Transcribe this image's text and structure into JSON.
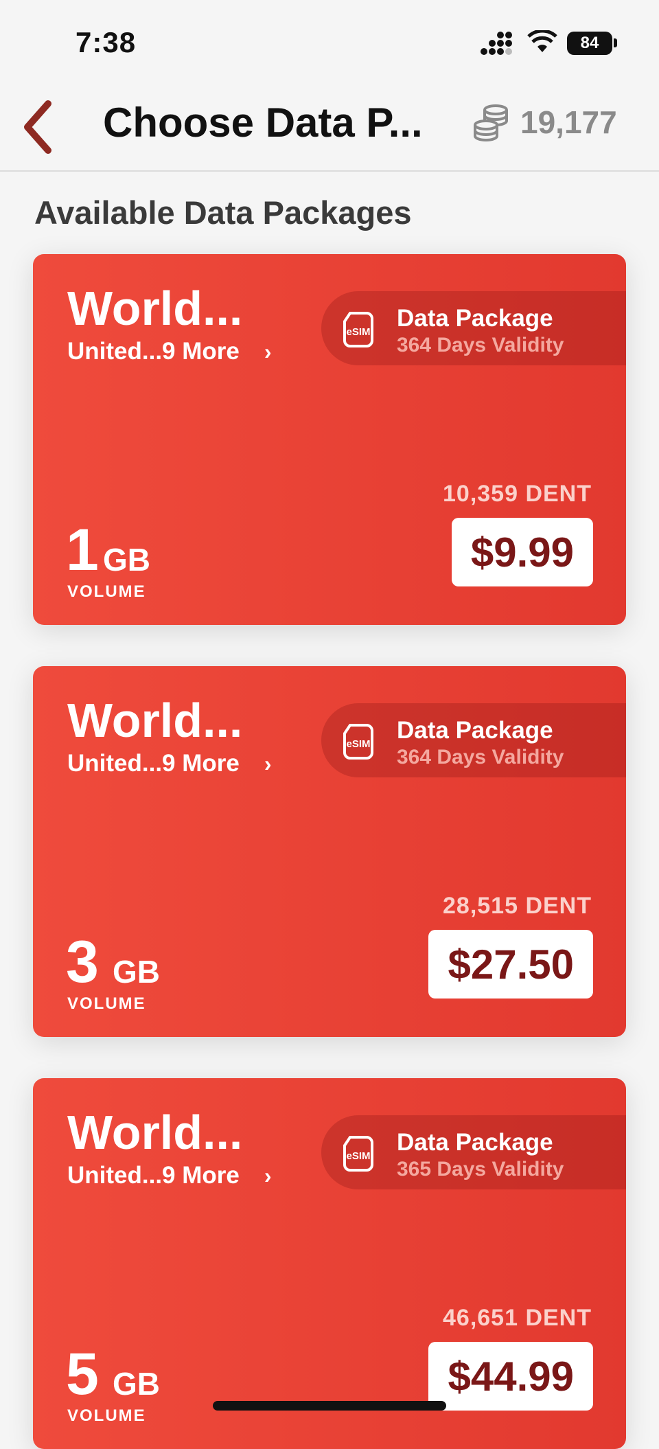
{
  "status_bar": {
    "time": "7:38",
    "battery": "84"
  },
  "nav": {
    "title": "Choose Data P...",
    "coin_balance": "19,177"
  },
  "section_heading": "Available Data Packages",
  "packages": [
    {
      "title": "World...",
      "subtitle": "United...9 More",
      "chevron": "›",
      "type": "Data Package",
      "validity": "364 Days Validity",
      "dent": "10,359 DENT",
      "price": "$9.99",
      "volume": "1",
      "unit": "GB",
      "volume_label": "VOLUME"
    },
    {
      "title": "World...",
      "subtitle": "United...9 More",
      "chevron": "›",
      "type": "Data Package",
      "validity": "364 Days Validity",
      "dent": "28,515 DENT",
      "price": "$27.50",
      "volume": "3",
      "unit": "GB",
      "volume_label": "VOLUME"
    },
    {
      "title": "World...",
      "subtitle": "United...9 More",
      "chevron": "›",
      "type": "Data Package",
      "validity": "365 Days Validity",
      "dent": "46,651 DENT",
      "price": "$44.99",
      "volume": "5",
      "unit": "GB",
      "volume_label": "VOLUME"
    }
  ],
  "esim_label": "eSIM",
  "colors": {
    "card": "#ef4b3c",
    "price_text": "#7a1717",
    "back_arrow": "#8e2a22"
  }
}
